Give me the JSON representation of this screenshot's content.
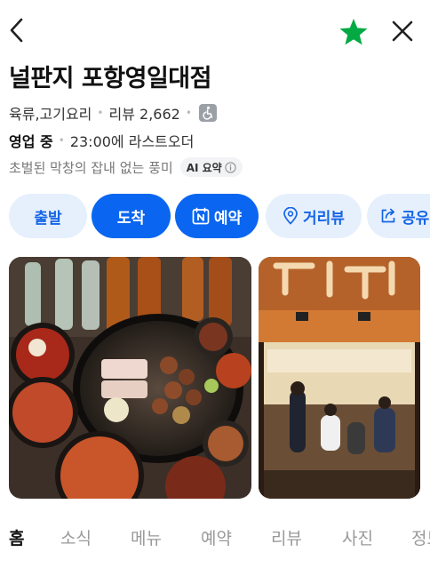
{
  "header": {
    "back_icon": "chevron-left-icon",
    "favorite_icon": "star-filled-icon",
    "favorite_color": "#03aa44",
    "close_icon": "close-icon"
  },
  "place": {
    "title": "널판지 포항영일대점",
    "category": "육류,고기요리",
    "review_label": "리뷰 2,662",
    "accessibility_icon": "wheelchair-icon",
    "open_status": "영업 중",
    "last_order": "23:00에 라스트오더",
    "ai_summary": "초벌된 막창의 잡내 없는 풍미",
    "ai_badge": "AI 요약"
  },
  "actions": [
    {
      "label": "출발",
      "style": "light"
    },
    {
      "label": "도착",
      "style": "primary"
    },
    {
      "label": "예약",
      "style": "primary",
      "icon": "naver-booking-icon"
    },
    {
      "label": "거리뷰",
      "style": "light",
      "icon": "location-pin-icon"
    },
    {
      "label": "공유",
      "style": "light",
      "icon": "share-icon"
    }
  ],
  "photos": [
    "food-photo",
    "storefront-photo"
  ],
  "tabs": [
    {
      "label": "홈",
      "active": true
    },
    {
      "label": "소식",
      "active": false
    },
    {
      "label": "메뉴",
      "active": false
    },
    {
      "label": "예약",
      "active": false
    },
    {
      "label": "리뷰",
      "active": false
    },
    {
      "label": "사진",
      "active": false
    },
    {
      "label": "정보",
      "active": false
    }
  ],
  "colors": {
    "accent": "#0a66f0",
    "accent_light_bg": "#e6f0fd",
    "accent_light_text": "#1565e6",
    "favorite": "#03aa44"
  }
}
